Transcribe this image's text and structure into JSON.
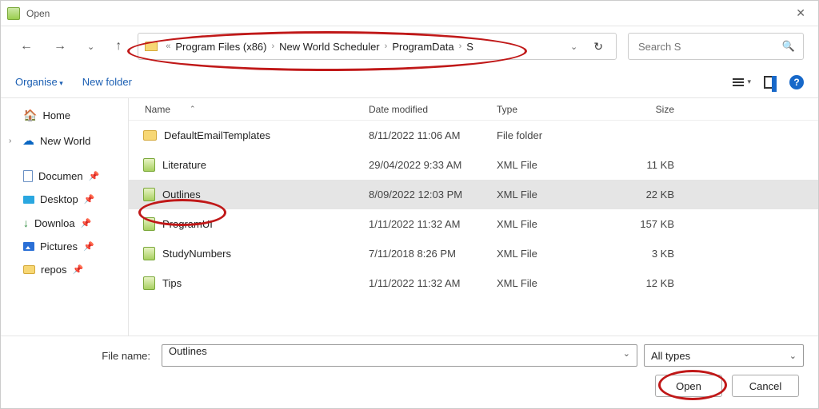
{
  "window": {
    "title": "Open"
  },
  "breadcrumb": {
    "prefix": "«",
    "parts": [
      "Program Files (x86)",
      "New World Scheduler",
      "ProgramData",
      "S"
    ]
  },
  "search": {
    "placeholder": "Search S"
  },
  "toolbar": {
    "organise": "Organise",
    "newfolder": "New folder"
  },
  "tree": {
    "home": "Home",
    "newworld": "New World",
    "documents": "Documen",
    "desktop": "Desktop",
    "downloads": "Downloa",
    "pictures": "Pictures",
    "repos": "repos"
  },
  "columns": {
    "name": "Name",
    "date": "Date modified",
    "type": "Type",
    "size": "Size"
  },
  "files": [
    {
      "name": "DefaultEmailTemplates",
      "date": "8/11/2022 11:06 AM",
      "type": "File folder",
      "size": "",
      "icon": "folder",
      "selected": false
    },
    {
      "name": "Literature",
      "date": "29/04/2022 9:33 AM",
      "type": "XML File",
      "size": "11 KB",
      "icon": "xml",
      "selected": false
    },
    {
      "name": "Outlines",
      "date": "8/09/2022 12:03 PM",
      "type": "XML File",
      "size": "22 KB",
      "icon": "xml",
      "selected": true
    },
    {
      "name": "ProgramUI",
      "date": "1/11/2022 11:32 AM",
      "type": "XML File",
      "size": "157 KB",
      "icon": "xml",
      "selected": false
    },
    {
      "name": "StudyNumbers",
      "date": "7/11/2018 8:26 PM",
      "type": "XML File",
      "size": "3 KB",
      "icon": "xml",
      "selected": false
    },
    {
      "name": "Tips",
      "date": "1/11/2022 11:32 AM",
      "type": "XML File",
      "size": "12 KB",
      "icon": "xml",
      "selected": false
    }
  ],
  "footer": {
    "filename_label": "File name:",
    "filename_value": "Outlines",
    "filter": "All types",
    "open": "Open",
    "cancel": "Cancel"
  }
}
